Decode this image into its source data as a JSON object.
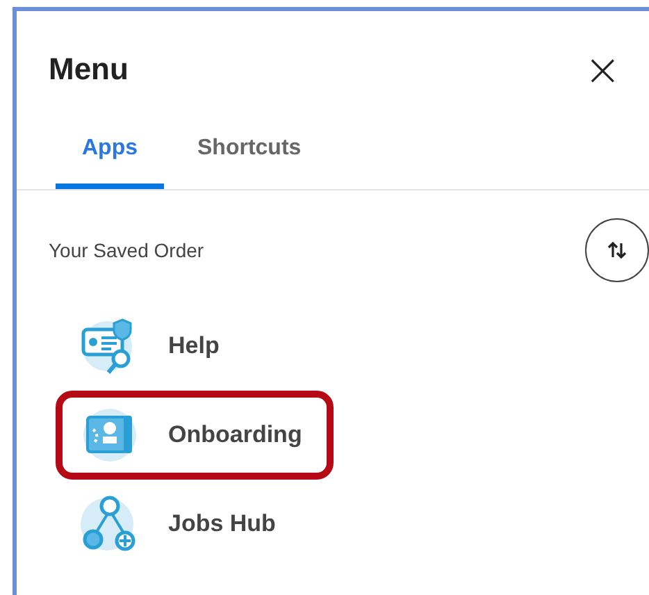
{
  "menu": {
    "title": "Menu",
    "close": "×"
  },
  "tabs": [
    {
      "label": "Apps",
      "selected": true
    },
    {
      "label": "Shortcuts",
      "selected": false
    }
  ],
  "section": {
    "label": "Your Saved Order"
  },
  "apps": [
    {
      "label": "Help",
      "highlighted": false
    },
    {
      "label": "Onboarding",
      "highlighted": true
    },
    {
      "label": "Jobs Hub",
      "highlighted": false
    }
  ]
}
